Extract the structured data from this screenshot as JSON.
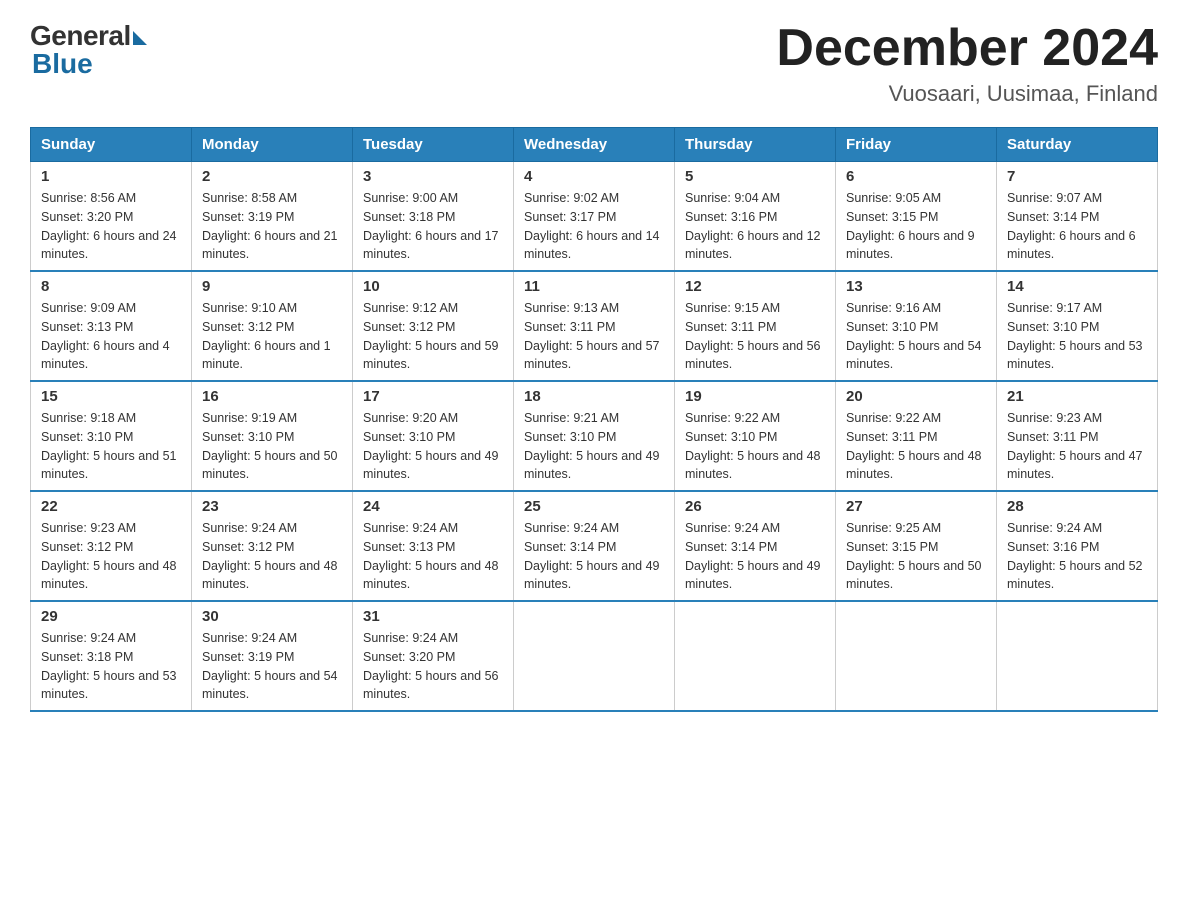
{
  "logo": {
    "general": "General",
    "blue": "Blue"
  },
  "title": "December 2024",
  "location": "Vuosaari, Uusimaa, Finland",
  "days_of_week": [
    "Sunday",
    "Monday",
    "Tuesday",
    "Wednesday",
    "Thursday",
    "Friday",
    "Saturday"
  ],
  "weeks": [
    [
      {
        "day": "1",
        "sunrise": "8:56 AM",
        "sunset": "3:20 PM",
        "daylight": "6 hours and 24 minutes."
      },
      {
        "day": "2",
        "sunrise": "8:58 AM",
        "sunset": "3:19 PM",
        "daylight": "6 hours and 21 minutes."
      },
      {
        "day": "3",
        "sunrise": "9:00 AM",
        "sunset": "3:18 PM",
        "daylight": "6 hours and 17 minutes."
      },
      {
        "day": "4",
        "sunrise": "9:02 AM",
        "sunset": "3:17 PM",
        "daylight": "6 hours and 14 minutes."
      },
      {
        "day": "5",
        "sunrise": "9:04 AM",
        "sunset": "3:16 PM",
        "daylight": "6 hours and 12 minutes."
      },
      {
        "day": "6",
        "sunrise": "9:05 AM",
        "sunset": "3:15 PM",
        "daylight": "6 hours and 9 minutes."
      },
      {
        "day": "7",
        "sunrise": "9:07 AM",
        "sunset": "3:14 PM",
        "daylight": "6 hours and 6 minutes."
      }
    ],
    [
      {
        "day": "8",
        "sunrise": "9:09 AM",
        "sunset": "3:13 PM",
        "daylight": "6 hours and 4 minutes."
      },
      {
        "day": "9",
        "sunrise": "9:10 AM",
        "sunset": "3:12 PM",
        "daylight": "6 hours and 1 minute."
      },
      {
        "day": "10",
        "sunrise": "9:12 AM",
        "sunset": "3:12 PM",
        "daylight": "5 hours and 59 minutes."
      },
      {
        "day": "11",
        "sunrise": "9:13 AM",
        "sunset": "3:11 PM",
        "daylight": "5 hours and 57 minutes."
      },
      {
        "day": "12",
        "sunrise": "9:15 AM",
        "sunset": "3:11 PM",
        "daylight": "5 hours and 56 minutes."
      },
      {
        "day": "13",
        "sunrise": "9:16 AM",
        "sunset": "3:10 PM",
        "daylight": "5 hours and 54 minutes."
      },
      {
        "day": "14",
        "sunrise": "9:17 AM",
        "sunset": "3:10 PM",
        "daylight": "5 hours and 53 minutes."
      }
    ],
    [
      {
        "day": "15",
        "sunrise": "9:18 AM",
        "sunset": "3:10 PM",
        "daylight": "5 hours and 51 minutes."
      },
      {
        "day": "16",
        "sunrise": "9:19 AM",
        "sunset": "3:10 PM",
        "daylight": "5 hours and 50 minutes."
      },
      {
        "day": "17",
        "sunrise": "9:20 AM",
        "sunset": "3:10 PM",
        "daylight": "5 hours and 49 minutes."
      },
      {
        "day": "18",
        "sunrise": "9:21 AM",
        "sunset": "3:10 PM",
        "daylight": "5 hours and 49 minutes."
      },
      {
        "day": "19",
        "sunrise": "9:22 AM",
        "sunset": "3:10 PM",
        "daylight": "5 hours and 48 minutes."
      },
      {
        "day": "20",
        "sunrise": "9:22 AM",
        "sunset": "3:11 PM",
        "daylight": "5 hours and 48 minutes."
      },
      {
        "day": "21",
        "sunrise": "9:23 AM",
        "sunset": "3:11 PM",
        "daylight": "5 hours and 47 minutes."
      }
    ],
    [
      {
        "day": "22",
        "sunrise": "9:23 AM",
        "sunset": "3:12 PM",
        "daylight": "5 hours and 48 minutes."
      },
      {
        "day": "23",
        "sunrise": "9:24 AM",
        "sunset": "3:12 PM",
        "daylight": "5 hours and 48 minutes."
      },
      {
        "day": "24",
        "sunrise": "9:24 AM",
        "sunset": "3:13 PM",
        "daylight": "5 hours and 48 minutes."
      },
      {
        "day": "25",
        "sunrise": "9:24 AM",
        "sunset": "3:14 PM",
        "daylight": "5 hours and 49 minutes."
      },
      {
        "day": "26",
        "sunrise": "9:24 AM",
        "sunset": "3:14 PM",
        "daylight": "5 hours and 49 minutes."
      },
      {
        "day": "27",
        "sunrise": "9:25 AM",
        "sunset": "3:15 PM",
        "daylight": "5 hours and 50 minutes."
      },
      {
        "day": "28",
        "sunrise": "9:24 AM",
        "sunset": "3:16 PM",
        "daylight": "5 hours and 52 minutes."
      }
    ],
    [
      {
        "day": "29",
        "sunrise": "9:24 AM",
        "sunset": "3:18 PM",
        "daylight": "5 hours and 53 minutes."
      },
      {
        "day": "30",
        "sunrise": "9:24 AM",
        "sunset": "3:19 PM",
        "daylight": "5 hours and 54 minutes."
      },
      {
        "day": "31",
        "sunrise": "9:24 AM",
        "sunset": "3:20 PM",
        "daylight": "5 hours and 56 minutes."
      },
      null,
      null,
      null,
      null
    ]
  ]
}
